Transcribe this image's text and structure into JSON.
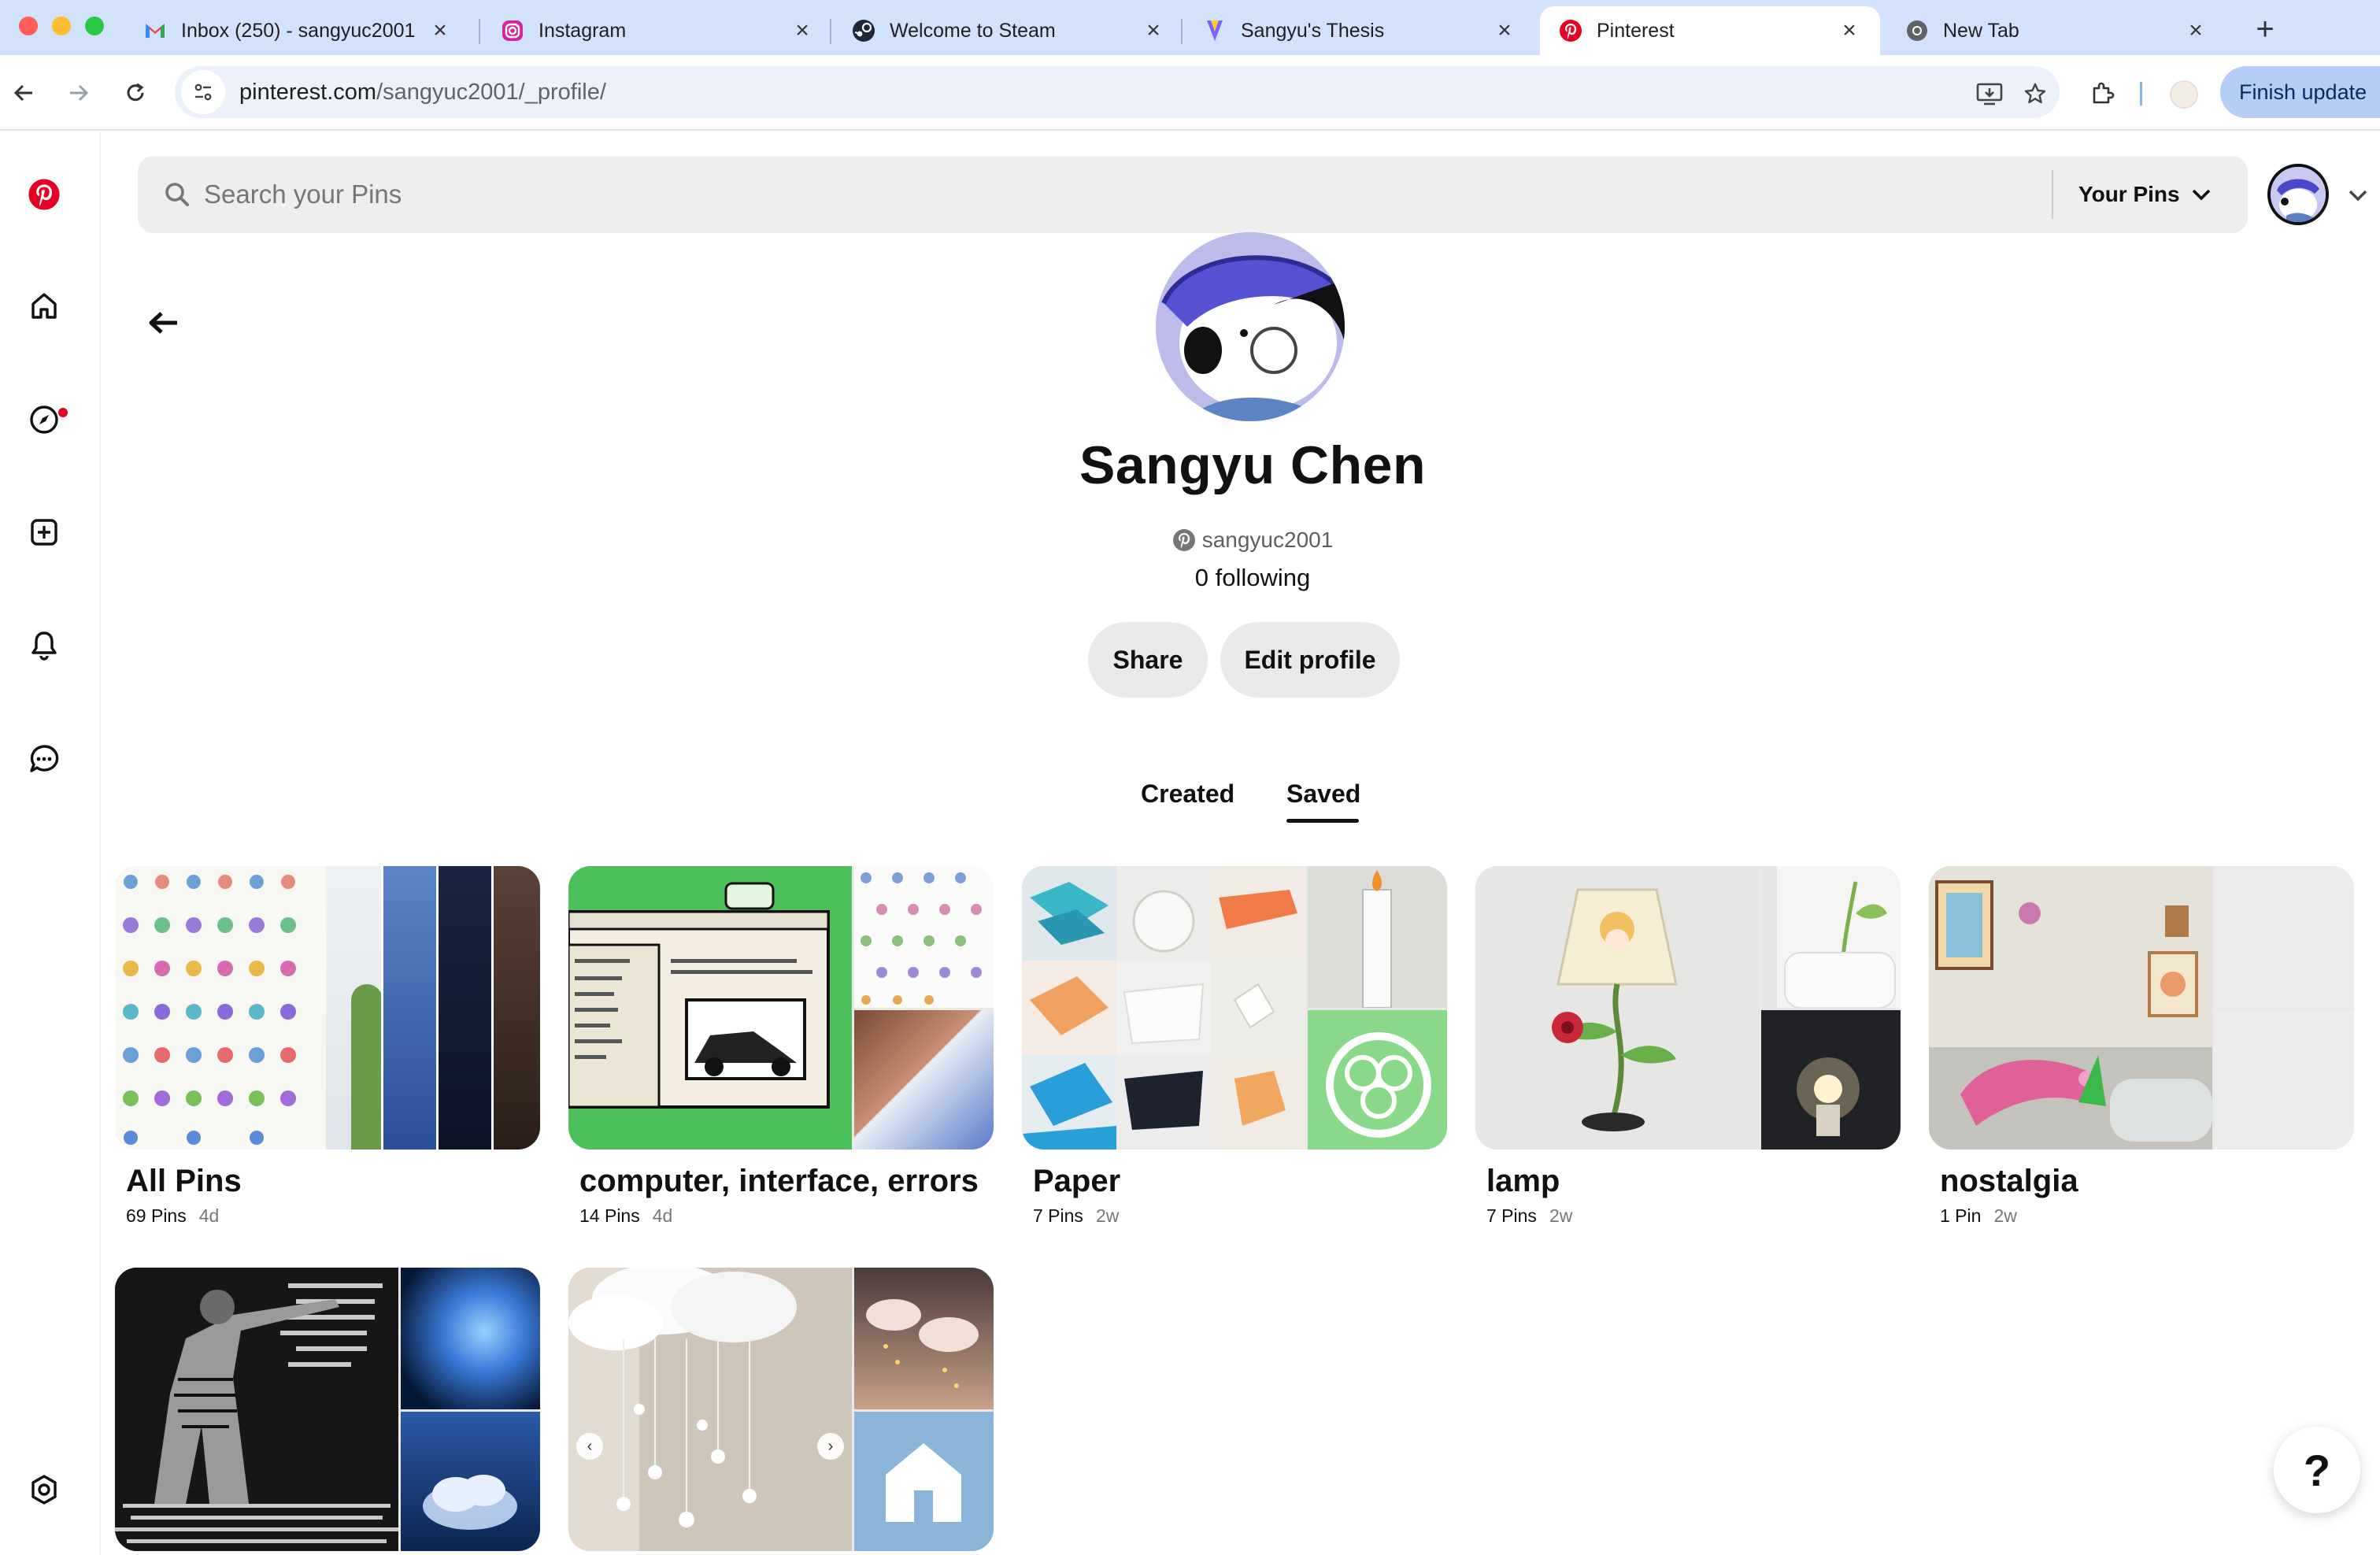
{
  "browser": {
    "tabs": [
      {
        "title": "Inbox (250) - sangyuc2001",
        "icon": "gmail-icon"
      },
      {
        "title": "Instagram",
        "icon": "instagram-icon"
      },
      {
        "title": "Welcome to Steam",
        "icon": "steam-icon"
      },
      {
        "title": "Sangyu's Thesis",
        "icon": "thesis-icon"
      },
      {
        "title": "Pinterest",
        "icon": "pinterest-icon",
        "active": true
      },
      {
        "title": "New Tab",
        "icon": "chrome-icon"
      }
    ],
    "close_glyph": "×",
    "new_tab_glyph": "+",
    "url_host": "pinterest.com",
    "url_path": "/sangyuc2001/_profile/",
    "update_button": "Finish update"
  },
  "colors": {
    "pinterest_red": "#e60023",
    "tab_strip": "#d3e2fb",
    "chip_bg": "#e9e9e9"
  },
  "sidebar": {
    "items": [
      {
        "icon": "pinterest-logo-icon"
      },
      {
        "icon": "home-icon"
      },
      {
        "icon": "explore-compass-icon",
        "has_notification_dot": true
      },
      {
        "icon": "create-plus-icon"
      },
      {
        "icon": "notifications-bell-icon"
      },
      {
        "icon": "messages-icon"
      },
      {
        "icon": "settings-icon"
      }
    ]
  },
  "search": {
    "placeholder": "Search your Pins",
    "filter_label": "Your Pins"
  },
  "profile": {
    "name": "Sangyu Chen",
    "username": "sangyuc2001",
    "following": "0 following",
    "share_label": "Share",
    "edit_label": "Edit profile"
  },
  "profile_tabs": [
    {
      "label": "Created",
      "active": false
    },
    {
      "label": "Saved",
      "active": true
    }
  ],
  "boards": [
    {
      "title": "All Pins",
      "pins": "69 Pins",
      "age": "4d"
    },
    {
      "title": "computer, interface, errors",
      "pins": "14 Pins",
      "age": "4d"
    },
    {
      "title": "Paper",
      "pins": "7 Pins",
      "age": "2w"
    },
    {
      "title": "lamp",
      "pins": "7 Pins",
      "age": "2w"
    },
    {
      "title": "nostalgia",
      "pins": "1 Pin",
      "age": "2w"
    },
    {
      "title": "",
      "pins": "",
      "age": ""
    },
    {
      "title": "",
      "pins": "",
      "age": ""
    }
  ],
  "help_label": "?"
}
